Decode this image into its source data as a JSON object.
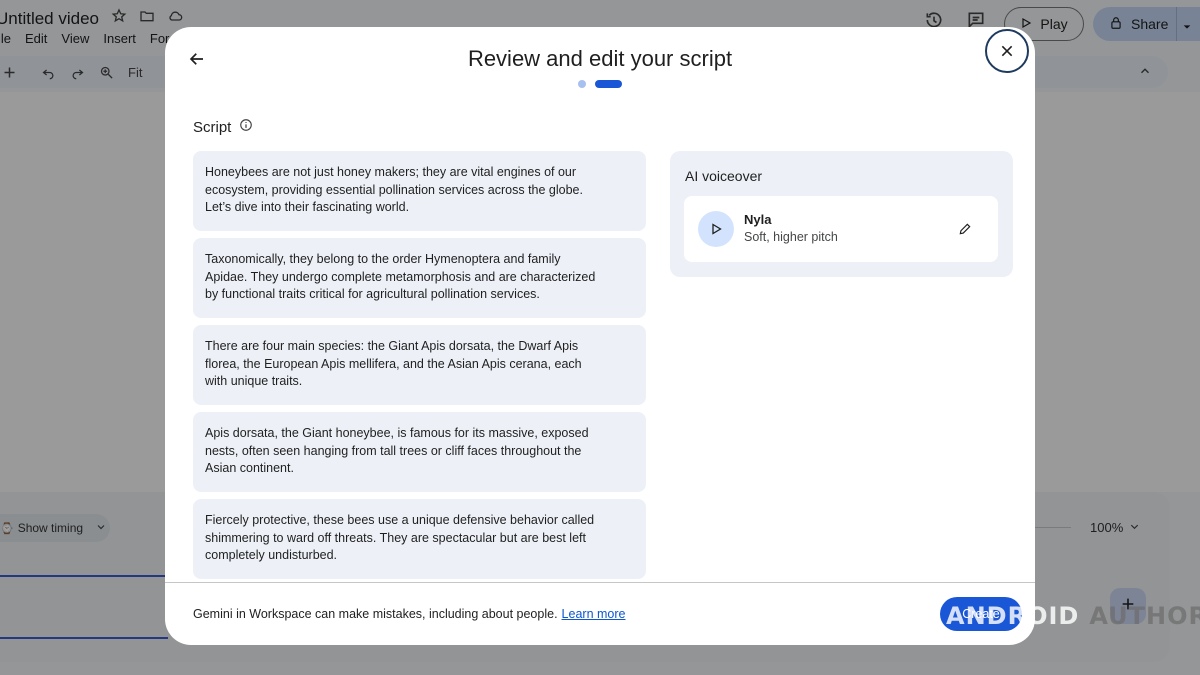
{
  "app": {
    "title": "Untitled video",
    "menu": [
      "File",
      "Edit",
      "View",
      "Insert",
      "Format"
    ],
    "toolbar": {
      "fit_label": "Fit"
    },
    "play_label": "Play",
    "share_label": "Share",
    "show_timing_label": "Show timing",
    "zoom_level": "100%"
  },
  "dialog": {
    "title": "Review and edit your script",
    "steps_total": 2,
    "current_step": 2,
    "script_label": "Script",
    "script_blocks": [
      "Honeybees are not just honey makers; they are vital engines of our ecosystem, providing essential pollination services across the globe. Let’s dive into their fascinating world.",
      "Taxonomically, they belong to the order Hymenoptera and family Apidae. They undergo complete metamorphosis and are characterized by functional traits critical for agricultural pollination services.",
      "There are four main species: the Giant Apis dorsata, the Dwarf Apis florea, the European Apis mellifera, and the Asian Apis cerana, each with unique traits.",
      "Apis dorsata, the Giant honeybee, is famous for its massive, exposed nests, often seen hanging from tall trees or cliff faces throughout the Asian continent.",
      "Fiercely protective, these bees use a unique defensive behavior called shimmering to ward off threats. They are spectacular but are best left completely undisturbed."
    ],
    "voiceover": {
      "title": "AI voiceover",
      "voice_name": "Nyla",
      "voice_desc": "Soft, higher pitch"
    },
    "footer": {
      "disclaimer": "Gemini in Workspace can make mistakes, including about people.",
      "learn_more": "Learn more"
    },
    "create_label": "Create"
  },
  "watermark": {
    "part1": "ANDROID",
    "part2": "AUTHORITY"
  },
  "colors": {
    "accent": "#1a57d6",
    "card_bg": "#edf1f7",
    "link": "#0b57d0"
  }
}
